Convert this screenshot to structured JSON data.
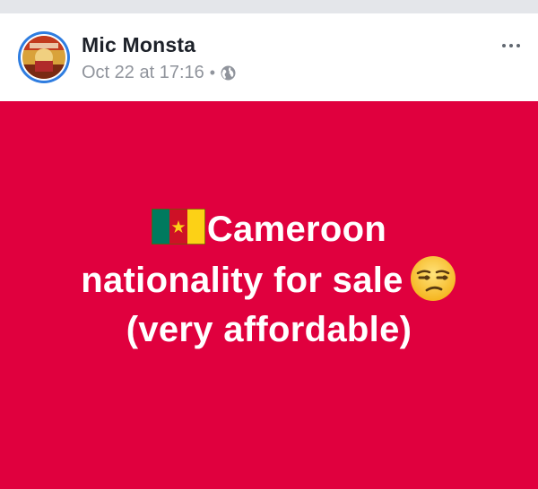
{
  "post": {
    "author_name": "Mic Monsta",
    "timestamp": "Oct 22 at 17:16",
    "separator": "•",
    "privacy_icon": "globe-icon",
    "menu_icon": "more-options-icon"
  },
  "status": {
    "background_color": "#e0003e",
    "line1": "Cameroon",
    "line2": "nationality for sale",
    "line3": "(very affordable)",
    "flag_icon": "cameroon-flag-icon",
    "emoji_icon": "unamused-face-icon"
  },
  "colors": {
    "flag_green": "#007a5e",
    "flag_red": "#ce1126",
    "flag_yellow": "#fcd116",
    "name_text": "#1d2129",
    "meta_text": "#90949c"
  }
}
